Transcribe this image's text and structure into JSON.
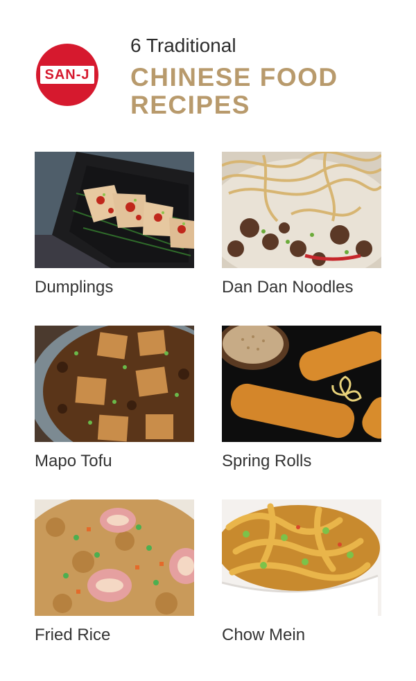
{
  "brand": {
    "logo_text": "SAN-J",
    "color": "#d6192e"
  },
  "header": {
    "subtitle": "6 Traditional",
    "title_line1": "CHINESE FOOD",
    "title_line2": "RECIPES",
    "title_color": "#b89a6c"
  },
  "recipes": [
    {
      "label": "Dumplings"
    },
    {
      "label": "Dan Dan Noodles"
    },
    {
      "label": "Mapo Tofu"
    },
    {
      "label": "Spring Rolls"
    },
    {
      "label": "Fried Rice"
    },
    {
      "label": "Chow Mein"
    }
  ]
}
